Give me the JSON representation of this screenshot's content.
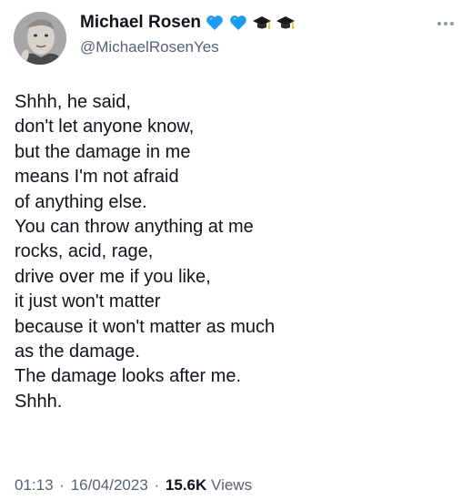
{
  "author": {
    "display_name": "Michael Rosen",
    "handle": "@MichaelRosenYes",
    "name_emojis": [
      "blue-heart-icon",
      "blue-heart-icon",
      "graduation-cap-icon",
      "graduation-cap-icon"
    ]
  },
  "tweet": {
    "lines": [
      "Shhh, he said,",
      "don't let anyone know,",
      "but the damage in me",
      "means I'm not afraid",
      "of anything else.",
      "You can throw anything at me",
      "rocks, acid, rage,",
      "drive over me if you like,",
      "it just won't matter",
      "because it won't matter as much",
      "as the damage.",
      "The damage looks after me.",
      "Shhh."
    ]
  },
  "meta": {
    "time": "01:13",
    "separator": "·",
    "date": "16/04/2023",
    "views_count": "15.6K",
    "views_label": "Views"
  },
  "colors": {
    "text": "#0f1419",
    "secondary": "#536471",
    "heart": "#1d9bf0"
  }
}
